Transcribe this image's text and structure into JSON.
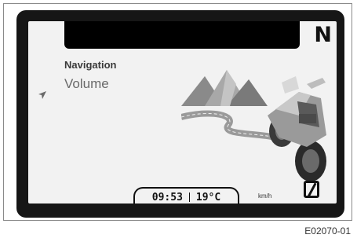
{
  "display": {
    "gear_indicator": "N",
    "menu": {
      "primary": "Navigation",
      "secondary": "Volume"
    },
    "status": {
      "time": "09:53",
      "temperature": "19°C",
      "speed_unit": "km/h"
    },
    "icons": [
      "navigation-arrow-icon",
      "neutral-indicator-icon"
    ]
  },
  "caption": "E02070-01"
}
